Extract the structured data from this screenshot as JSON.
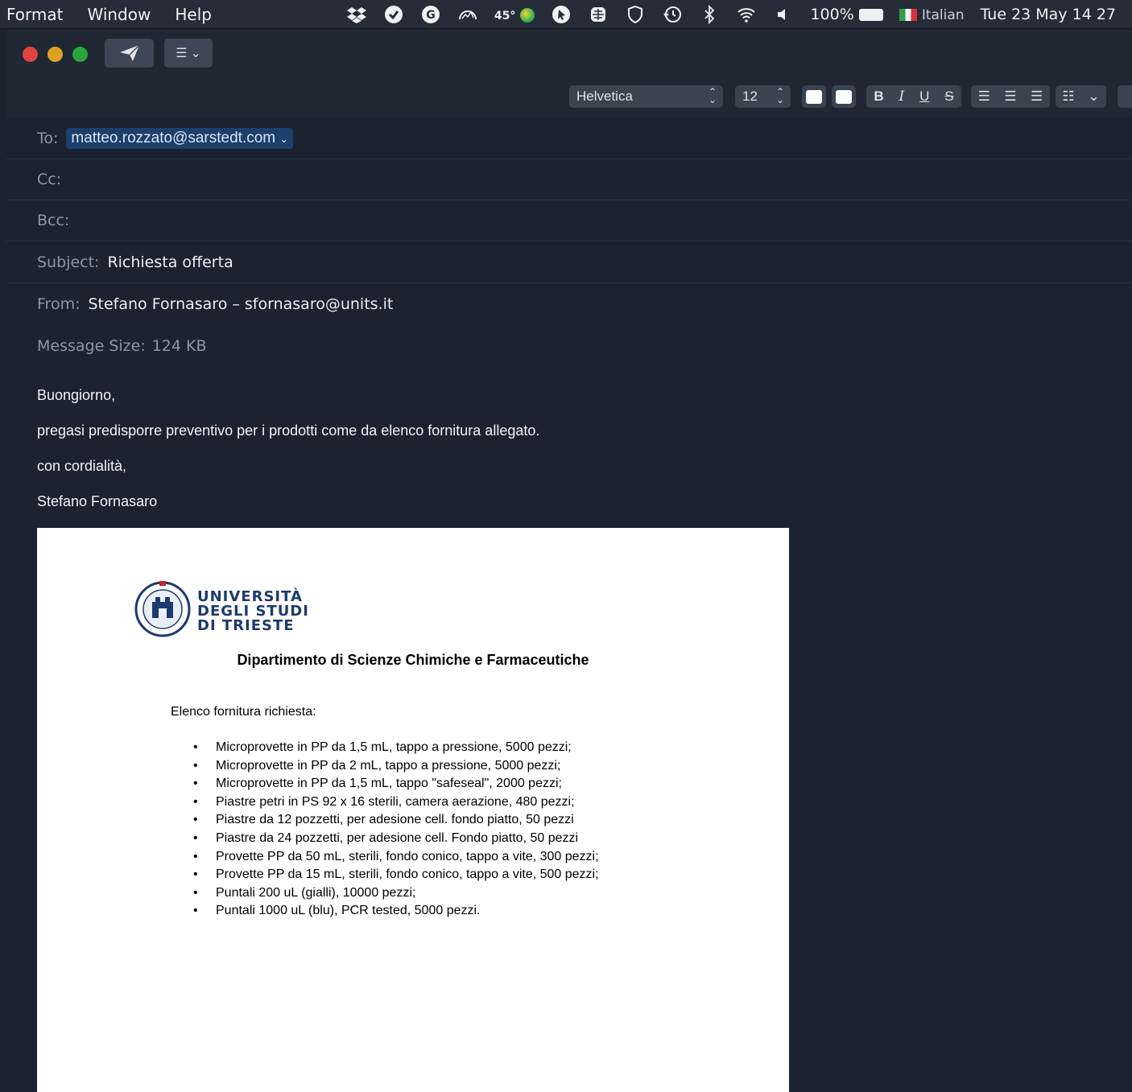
{
  "menubar": {
    "items": [
      "Format",
      "Window",
      "Help"
    ],
    "temperature": "45°",
    "battery": "100%",
    "language": "Italian",
    "datetime": "Tue 23 May  14 27"
  },
  "toolbar": {
    "font_name": "Helvetica",
    "font_size": "12",
    "bold": "B",
    "italic": "I",
    "underline": "U",
    "strike": "S"
  },
  "header": {
    "to_label": "To:",
    "to_value": "matteo.rozzato@sarstedt.com",
    "cc_label": "Cc:",
    "bcc_label": "Bcc:",
    "subject_label": "Subject:",
    "subject_value": "Richiesta offerta",
    "from_label": "From:",
    "from_value": "Stefano Fornasaro – sfornasaro@units.it",
    "size_label": "Message Size:",
    "size_value": "124 KB"
  },
  "body": {
    "lines": [
      "Buongiorno,",
      "pregasi predisporre preventivo per i prodotti come da elenco fornitura allegato.",
      "con cordialità,",
      "Stefano Fornasaro"
    ]
  },
  "attachment": {
    "university": [
      "UNIVERSITÀ",
      "DEGLI STUDI",
      "DI TRIESTE"
    ],
    "department": "Dipartimento di Scienze Chimiche e Farmaceutiche",
    "list_heading": "Elenco fornitura richiesta:",
    "items": [
      "Microprovette in PP da 1,5 mL, tappo a pressione, 5000 pezzi;",
      "Microprovette in PP da 2 mL, tappo a pressione, 5000 pezzi;",
      "Microprovette in PP da 1,5 mL, tappo \"safeseal\", 2000 pezzi;",
      "Piastre petri in PS 92 x 16 sterili, camera aerazione, 480 pezzi;",
      "Piastre da 12 pozzetti, per adesione cell. fondo piatto, 50 pezzi",
      "Piastre da 24 pozzetti, per adesione cell. Fondo piatto, 50 pezzi",
      "Provette PP da 50 mL, sterili, fondo conico, tappo a vite, 300 pezzi;",
      "Provette PP da 15 mL, sterili, fondo conico, tappo a vite, 500 pezzi;",
      "Puntali 200 uL (gialli), 10000 pezzi;",
      "Puntali 1000 uL (blu), PCR tested, 5000 pezzi."
    ]
  }
}
